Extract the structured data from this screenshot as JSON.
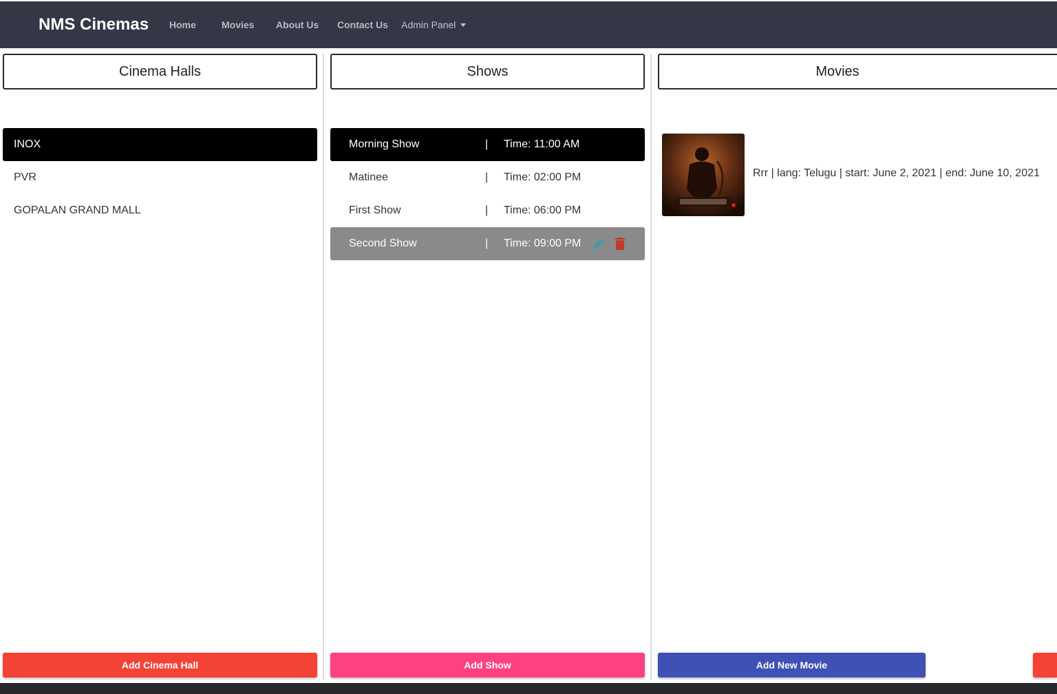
{
  "navbar": {
    "brand": "NMS Cinemas",
    "links": [
      "Home",
      "Movies",
      "About Us",
      "Contact Us"
    ],
    "admin_label": "Admin Panel"
  },
  "columns": {
    "halls_title": "Cinema Halls",
    "shows_title": "Shows",
    "movies_title": "Movies"
  },
  "halls": [
    {
      "name": "INOX",
      "selected": true
    },
    {
      "name": "PVR",
      "selected": false
    },
    {
      "name": "GOPALAN GRAND MALL",
      "selected": false
    }
  ],
  "shows": [
    {
      "name": "Morning Show",
      "sep": "|",
      "time": "Time: 11:00 AM",
      "state": "selected"
    },
    {
      "name": "Matinee",
      "sep": "|",
      "time": "Time: 02:00 PM",
      "state": "normal"
    },
    {
      "name": "First Show",
      "sep": "|",
      "time": "Time: 06:00 PM",
      "state": "normal"
    },
    {
      "name": "Second Show",
      "sep": "|",
      "time": "Time: 09:00 PM",
      "state": "hover"
    }
  ],
  "movies": [
    {
      "info": "Rrr | lang: Telugu | start: June 2, 2021 | end: June 10, 2021"
    }
  ],
  "buttons": {
    "add_hall": "Add Cinema Hall",
    "add_show": "Add Show",
    "add_movie": "Add New Movie"
  },
  "colors": {
    "navbar": "#343746",
    "add_hall": "#f44336",
    "add_show": "#ff4081",
    "add_movie": "#3f51b5",
    "edit_icon": "#2aa0b8",
    "delete_icon": "#c0392b"
  }
}
